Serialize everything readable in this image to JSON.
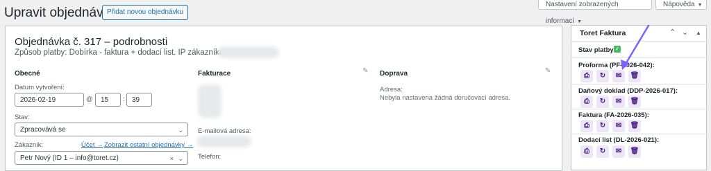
{
  "header": {
    "title": "Upravit objednávku",
    "add_button": "Přidat novou objednávku",
    "screen_options": "Nastavení zobrazených informací",
    "help": "Nápověda"
  },
  "order": {
    "title": "Objednávka č. 317 – podrobnosti",
    "payment_line": "Způsob platby: Dobírka - faktura + dodací list. IP zákazníka:",
    "general": {
      "heading": "Obecné",
      "date_label": "Datum vytvoření:",
      "date_value": "2026-02-19",
      "at": "@",
      "hour": "15",
      "colon": ":",
      "minute": "39",
      "status_label": "Stav:",
      "status_value": "Zpracovává se",
      "customer_label": "Zákazník:",
      "customer_link_profile": "Účet →",
      "customer_link_orders": "Zobrazit ostatní objednávky →",
      "customer_value": "Petr Nový (ID 1 – info@toret.cz)",
      "clear": "×"
    },
    "billing": {
      "heading": "Fakturace",
      "email_label": "E-mailová adresa:",
      "phone_label": "Telefon:"
    },
    "shipping": {
      "heading": "Doprava",
      "address_label": "Adresa:",
      "address_value": "Nebyla nastavena žádná doručovací adresa."
    }
  },
  "sidebar": {
    "title": "Toret Faktura",
    "status_label": "Stav platby:",
    "documents": [
      {
        "label": "Proforma (PF-2026-042):"
      },
      {
        "label": "Daňový doklad (DDP-2026-017):"
      },
      {
        "label": "Faktura (FA-2026-035):"
      },
      {
        "label": "Dodací list (DL-2026-021):"
      }
    ]
  },
  "colors": {
    "accent": "#2271b1",
    "annotation_arrow": "#7b61ff",
    "action_button_bg": "#ede6f7",
    "action_icon": "#4b1e85",
    "paid_check": "#4ab866"
  }
}
